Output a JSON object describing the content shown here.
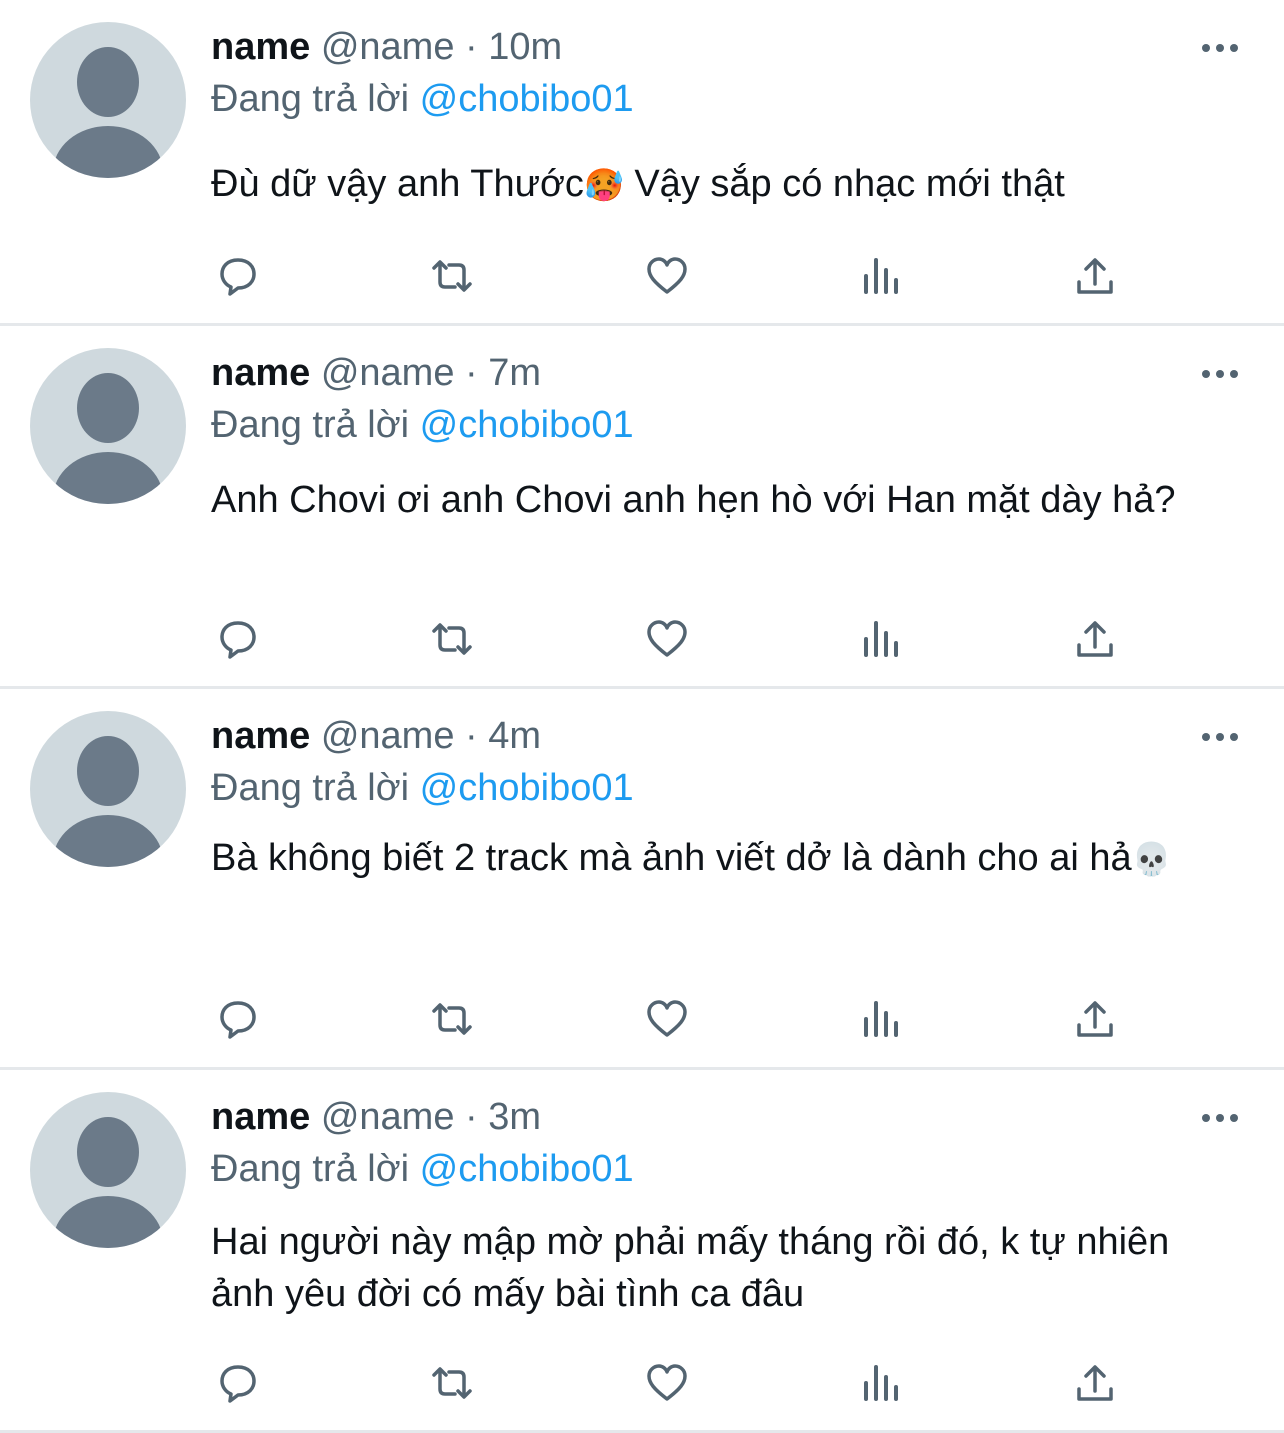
{
  "icons": {
    "reply": "reply-icon",
    "retweet": "retweet-icon",
    "like": "heart-icon",
    "views": "views-icon",
    "share": "share-icon",
    "more": "more-icon",
    "avatar": "default-avatar-icon"
  },
  "colors": {
    "text": "#0f1419",
    "secondary": "#536471",
    "mention": "#1d9bf0",
    "divider": "#e5e8eb",
    "avatar_bg": "#cfd9de",
    "avatar_fg": "#6b7a89"
  },
  "tweets": [
    {
      "name": "name",
      "handle": "@name",
      "dot": "·",
      "time": "10m",
      "reply_prefix": "Đang trả lời",
      "reply_to": "@chobibo01",
      "text_before": "Đù dữ vậy anh Thước",
      "emoji": "🥵",
      "text_after": " Vậy sắp có nhạc mới thật"
    },
    {
      "name": "name",
      "handle": "@name",
      "dot": "·",
      "time": "7m",
      "reply_prefix": "Đang trả lời",
      "reply_to": "@chobibo01",
      "text_before": "Anh Chovi ơi anh Chovi anh hẹn hò với Han mặt dày hả?",
      "emoji": "",
      "text_after": ""
    },
    {
      "name": "name",
      "handle": "@name",
      "dot": "·",
      "time": "4m",
      "reply_prefix": "Đang trả lời",
      "reply_to": "@chobibo01",
      "text_before": "Bà không biết 2 track mà ảnh viết dở là dành cho ai hả",
      "emoji": "💀",
      "text_after": ""
    },
    {
      "name": "name",
      "handle": "@name",
      "dot": "·",
      "time": "3m",
      "reply_prefix": "Đang trả lời",
      "reply_to": "@chobibo01",
      "text_before": "Hai người này mập mờ phải mấy tháng rồi đó, k tự nhiên ảnh yêu đời có mấy bài tình ca đâu",
      "emoji": "",
      "text_after": ""
    }
  ]
}
